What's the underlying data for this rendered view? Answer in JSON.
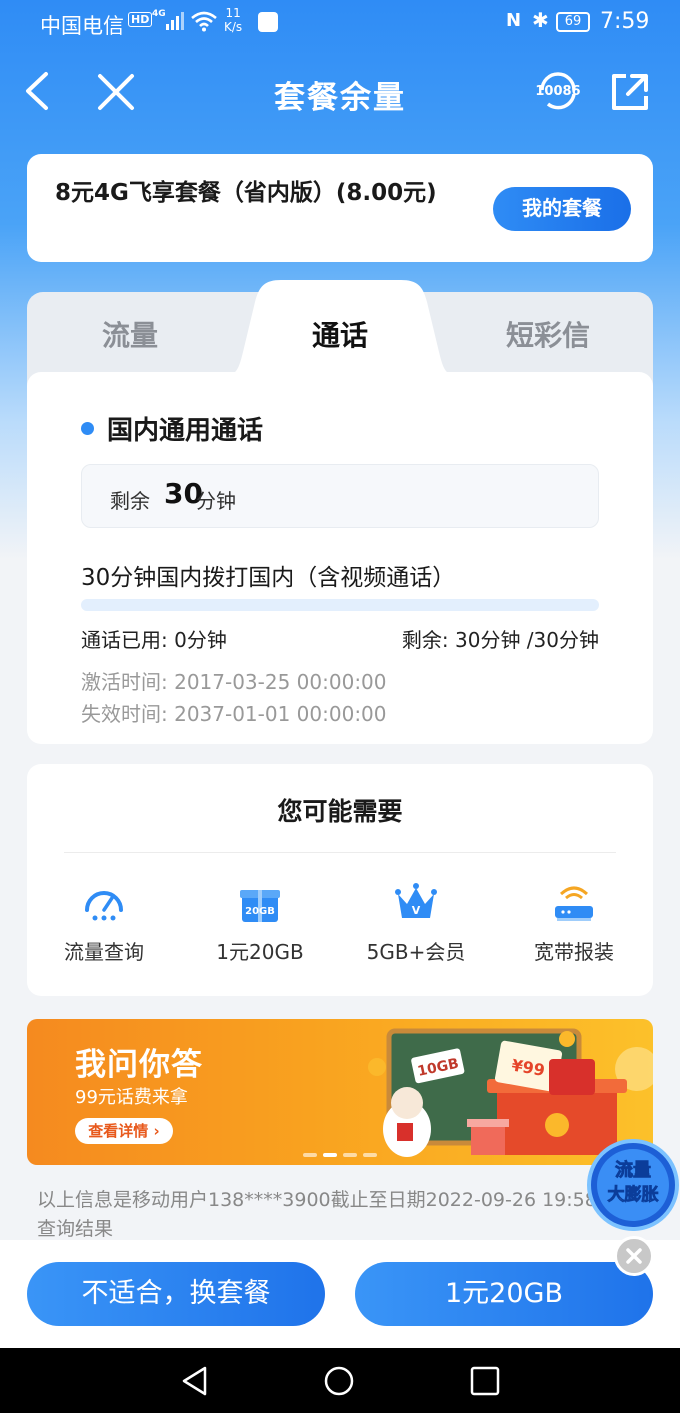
{
  "status_bar": {
    "carrier": "中国电信",
    "hd": "HD",
    "network": "4G",
    "speed_value": "11",
    "speed_unit": "K/s",
    "nfc": "N",
    "battery": "69",
    "time": "7:59"
  },
  "nav": {
    "title": "套餐余量",
    "hotline": "10086"
  },
  "plan": {
    "name": "8元4G飞享套餐（省内版）(8.00元)",
    "my_plan_label": "我的套餐"
  },
  "tabs": [
    {
      "label": "流量",
      "active": false
    },
    {
      "label": "通话",
      "active": true
    },
    {
      "label": "短彩信",
      "active": false
    }
  ],
  "call": {
    "section_title": "国内通用通话",
    "remain_prefix": "剩余",
    "remain_value": "30",
    "remain_unit": "分钟",
    "description": "30分钟国内拨打国内（含视频通话）",
    "used_fraction": 0,
    "used_text": "通话已用: 0分钟",
    "rest_text": "剩余: 30分钟 /30分钟",
    "activation": "激活时间: 2017-03-25 00:00:00",
    "expiry": "失效时间: 2037-01-01 00:00:00"
  },
  "recommend": {
    "title": "您可能需要",
    "items": [
      {
        "label": "流量查询",
        "icon": "speedometer-icon"
      },
      {
        "label": "1元20GB",
        "icon": "gift-box-icon",
        "badge": "20GB"
      },
      {
        "label": "5GB+会员",
        "icon": "crown-icon"
      },
      {
        "label": "宽带报装",
        "icon": "router-icon"
      }
    ]
  },
  "banner": {
    "title": "我问你答",
    "subtitle": "99元话费来拿",
    "button": "查看详情",
    "board_text": "10GB",
    "coupon_text": "¥99"
  },
  "query_info": "以上信息是移动用户138****3900截止至日期2022-09-26 19:58的查询结果",
  "float_badge": {
    "line1": "流量",
    "line2": "大膨胀"
  },
  "bottom": {
    "change_label": "不适合，换套餐",
    "buy_label": "1元20GB"
  },
  "colors": {
    "primary": "#2f8cf5",
    "banner_orange": "#f9a21f"
  }
}
